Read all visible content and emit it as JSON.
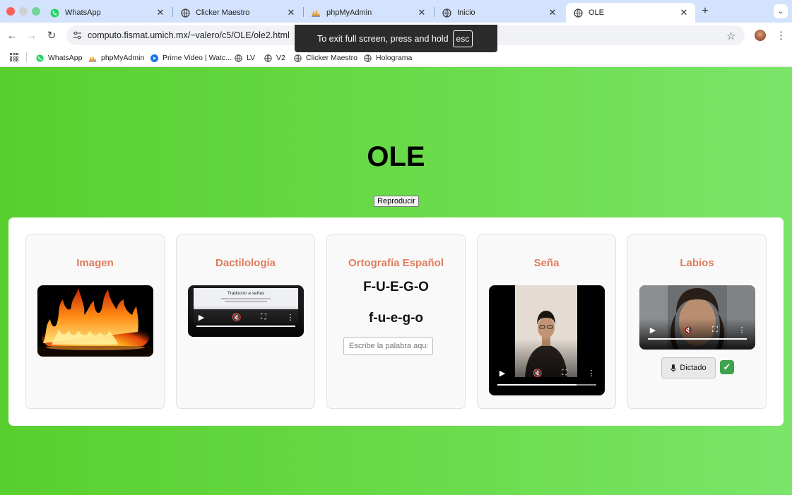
{
  "tabs": [
    {
      "title": "WhatsApp",
      "icon": "whatsapp-icon",
      "active": false
    },
    {
      "title": "Clicker Maestro",
      "icon": "globe-icon",
      "active": false
    },
    {
      "title": "phpMyAdmin",
      "icon": "phpmyadmin-icon",
      "active": false
    },
    {
      "title": "Inicio",
      "icon": "globe-icon",
      "active": false
    },
    {
      "title": "OLE",
      "icon": "globe-icon",
      "active": true
    }
  ],
  "toolbar": {
    "url": "computo.fismat.umich.mx/~valero/c5/OLE/ole2.html"
  },
  "fullscreen_toast": {
    "message": "To exit full screen, press and hold",
    "key": "esc"
  },
  "bookmarks": [
    {
      "label": "WhatsApp",
      "icon": "whatsapp-icon"
    },
    {
      "label": "phpMyAdmin",
      "icon": "phpmyadmin-icon"
    },
    {
      "label": "Prime Video | Watc...",
      "icon": "prime-video-icon"
    },
    {
      "label": "LV",
      "icon": "globe-icon"
    },
    {
      "label": "V2",
      "icon": "globe-icon"
    },
    {
      "label": "Clicker Maestro",
      "icon": "globe-icon"
    },
    {
      "label": "Holograma",
      "icon": "globe-icon"
    }
  ],
  "page": {
    "title": "OLE",
    "play_button": "Reproducir"
  },
  "cards": {
    "imagen": {
      "heading": "Imagen"
    },
    "dactilologia": {
      "heading": "Dactilología",
      "video_caption": "Traductor a señas",
      "progress": 1.0
    },
    "ortografia": {
      "heading": "Ortografía Español",
      "word_upper": "F-U-E-G-O",
      "word_lower": "f-u-e-g-o",
      "input_placeholder": "Escribe la palabra aquí"
    },
    "sena": {
      "heading": "Seña",
      "progress": 0.8
    },
    "labios": {
      "heading": "Labios",
      "progress": 1.0,
      "dictado_label": "Dictado"
    }
  },
  "colors": {
    "heading": "#e07c5e",
    "page_bg_start": "#58cf2e",
    "page_bg_end": "#7ae56a",
    "check": "#3fa34d"
  }
}
